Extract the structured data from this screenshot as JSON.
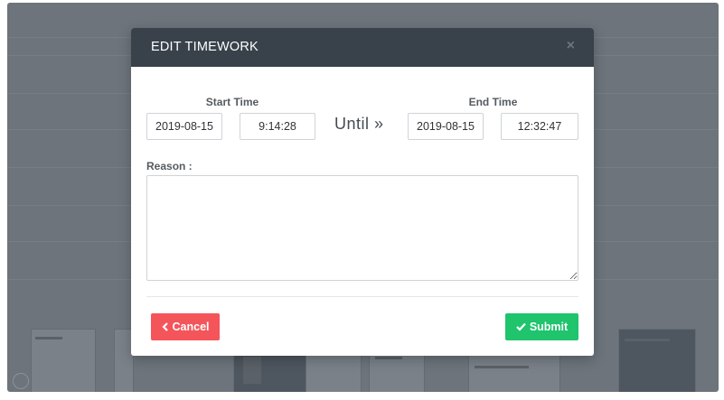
{
  "modal": {
    "title": "EDIT TIMEWORK",
    "close_label": "×",
    "start_label": "Start Time",
    "end_label": "End Time",
    "start_date": "2019-08-15",
    "start_time": "9:14:28",
    "until_label": "Until »",
    "end_date": "2019-08-15",
    "end_time": "12:32:47",
    "reason_label": "Reason :",
    "reason_value": "",
    "cancel_label": "Cancel",
    "submit_label": "Submit"
  },
  "colors": {
    "header": "#39424b",
    "cancel": "#f4555a",
    "submit": "#1fc46d",
    "overlay": "#6d747c"
  },
  "icons": {
    "cancel": "chevron-left-icon",
    "submit": "check-icon",
    "close": "close-icon"
  }
}
